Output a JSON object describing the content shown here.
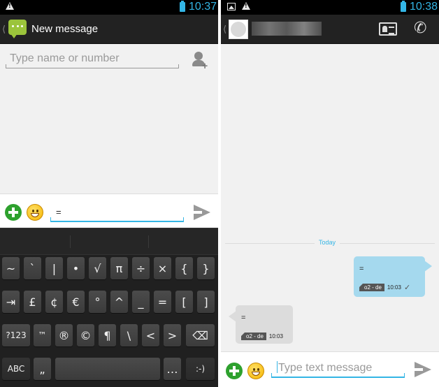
{
  "left": {
    "status": {
      "time": "10:37"
    },
    "actionbar": {
      "title": "New message"
    },
    "recipient": {
      "placeholder": "Type name or number"
    },
    "compose": {
      "text": "="
    },
    "keyboard": {
      "rows": [
        [
          "~",
          "`",
          "|",
          "•",
          "√",
          "π",
          "÷",
          "×",
          "{",
          "}"
        ],
        [
          "⇥",
          "£",
          "¢",
          "€",
          "°",
          "^",
          "_",
          "=",
          "[",
          "]"
        ],
        [
          "?123",
          "™",
          "®",
          "©",
          "¶",
          "\\",
          "<",
          ">",
          "⌫"
        ],
        [
          "ABC",
          "„",
          "",
          "…",
          ":-)"
        ]
      ]
    }
  },
  "right": {
    "status": {
      "time": "10:38"
    },
    "date_label": "Today",
    "outgoing": {
      "text": "=",
      "carrier": "o2 - de",
      "time": "10:03",
      "status": "✓"
    },
    "incoming": {
      "text": "=",
      "carrier": "o2 - de",
      "time": "10:03"
    },
    "compose": {
      "placeholder": "Type text message"
    }
  },
  "colors": {
    "accent": "#33b5e5",
    "app_green": "#9bc43b",
    "plus_green": "#2ea12e",
    "bubble_out": "#a5d9ee",
    "bubble_in": "#dcdcdc"
  },
  "icons": {
    "status": [
      "warning-icon",
      "picture-icon",
      "battery-icon"
    ],
    "actions": [
      "messaging-app-icon",
      "add-contact-icon",
      "contact-card-icon",
      "phone-icon",
      "attach-icon",
      "emoji-icon",
      "send-icon"
    ]
  }
}
